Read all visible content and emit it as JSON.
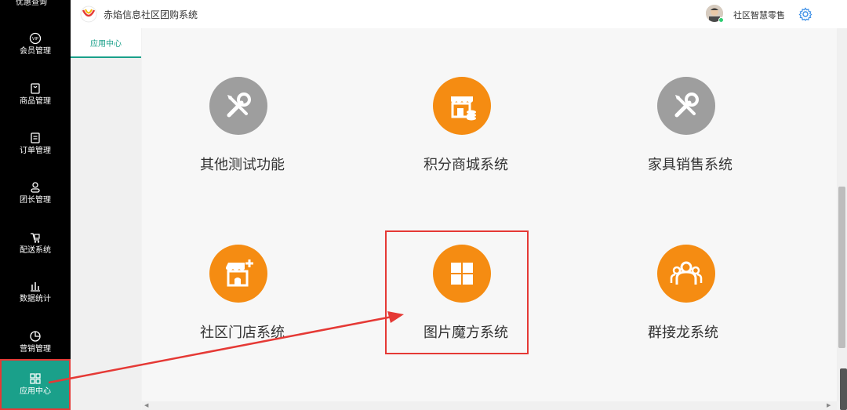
{
  "sidebar": {
    "top_cut_label": "优惠查询",
    "items": [
      {
        "label": "会员管理",
        "icon": "vip-icon"
      },
      {
        "label": "商品管理",
        "icon": "product-icon"
      },
      {
        "label": "订单管理",
        "icon": "order-icon"
      },
      {
        "label": "团长管理",
        "icon": "leader-icon"
      },
      {
        "label": "配送系统",
        "icon": "delivery-icon"
      },
      {
        "label": "数据统计",
        "icon": "bar-chart-icon"
      },
      {
        "label": "营销管理",
        "icon": "pie-chart-icon"
      },
      {
        "label": "应用中心",
        "icon": "grid-icon",
        "active": true
      }
    ]
  },
  "header": {
    "app_title": "赤焰信息社区团购系统",
    "user_name": "社区智慧零售"
  },
  "tabs": [
    {
      "label": "应用中心",
      "active": true
    }
  ],
  "apps": [
    {
      "label": "其他测试功能",
      "icon": "wrench-screwdriver-icon",
      "color": "#9e9e9e"
    },
    {
      "label": "积分商城系统",
      "icon": "store-coins-icon",
      "color": "#f58c12"
    },
    {
      "label": "家具销售系统",
      "icon": "wrench-screwdriver-icon",
      "color": "#9e9e9e"
    },
    {
      "label": "社区门店系统",
      "icon": "store-add-icon",
      "color": "#f58c12"
    },
    {
      "label": "图片魔方系统",
      "icon": "image-cube-icon",
      "color": "#f58c12",
      "highlighted": true
    },
    {
      "label": "群接龙系统",
      "icon": "group-icon",
      "color": "#f58c12"
    }
  ],
  "colors": {
    "accent": "#1aa08a",
    "orange": "#f58c12",
    "grey": "#9e9e9e",
    "highlight": "#e53935"
  }
}
